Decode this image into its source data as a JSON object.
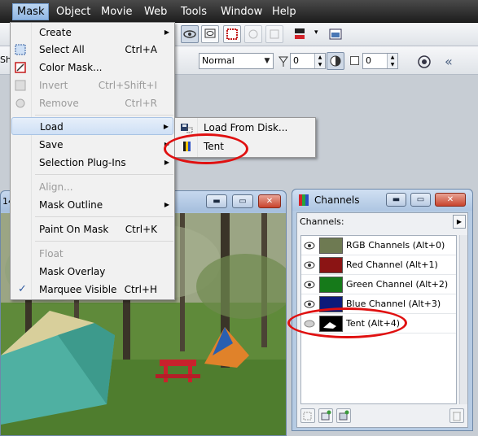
{
  "menubar": {
    "items": [
      "Mask",
      "Object",
      "Movie",
      "Web",
      "Tools",
      "Window",
      "Help"
    ],
    "active": "Mask"
  },
  "toolbar": {
    "left_clip_text": "Sh",
    "merge_mode": "Normal",
    "transparency_value": "0",
    "feather_value": "0"
  },
  "mask_menu": {
    "items": [
      {
        "label": "Create",
        "shortcut": "",
        "submenu": true,
        "disabled": false
      },
      {
        "label": "Select All",
        "shortcut": "Ctrl+A",
        "submenu": false,
        "disabled": false
      },
      {
        "label": "Color Mask...",
        "shortcut": "",
        "submenu": false,
        "disabled": false
      },
      {
        "label": "Invert",
        "shortcut": "Ctrl+Shift+I",
        "submenu": false,
        "disabled": true
      },
      {
        "label": "Remove",
        "shortcut": "Ctrl+R",
        "submenu": false,
        "disabled": true
      },
      {
        "label": "Load",
        "shortcut": "",
        "submenu": true,
        "disabled": false,
        "highlighted": true
      },
      {
        "label": "Save",
        "shortcut": "",
        "submenu": true,
        "disabled": false
      },
      {
        "label": "Selection Plug-Ins",
        "shortcut": "",
        "submenu": true,
        "disabled": false
      },
      {
        "label": "Align...",
        "shortcut": "",
        "submenu": false,
        "disabled": true
      },
      {
        "label": "Mask Outline",
        "shortcut": "",
        "submenu": true,
        "disabled": false
      },
      {
        "label": "Paint On Mask",
        "shortcut": "Ctrl+K",
        "submenu": false,
        "disabled": false
      },
      {
        "label": "Float",
        "shortcut": "",
        "submenu": false,
        "disabled": true
      },
      {
        "label": "Mask Overlay",
        "shortcut": "",
        "submenu": false,
        "disabled": false
      },
      {
        "label": "Marquee Visible",
        "shortcut": "Ctrl+H",
        "submenu": false,
        "disabled": false,
        "checked": true
      }
    ]
  },
  "load_submenu": {
    "items": [
      "Load From Disk...",
      "Tent"
    ]
  },
  "image_window": {
    "title_fragment": "14"
  },
  "channels_panel": {
    "title": "Channels",
    "header_label": "Channels:",
    "channels": [
      {
        "name": "RGB Channels",
        "shortcut": "(Alt+0)"
      },
      {
        "name": "Red Channel",
        "shortcut": "(Alt+1)"
      },
      {
        "name": "Green Channel",
        "shortcut": "(Alt+2)"
      },
      {
        "name": "Blue Channel",
        "shortcut": "(Alt+3)"
      },
      {
        "name": "Tent",
        "shortcut": "(Alt+4)"
      }
    ]
  },
  "colors": {
    "annotation_red": "#e01010",
    "menubar_bg": "#2a2a2a",
    "highlight_blue": "#cfe0f5"
  }
}
